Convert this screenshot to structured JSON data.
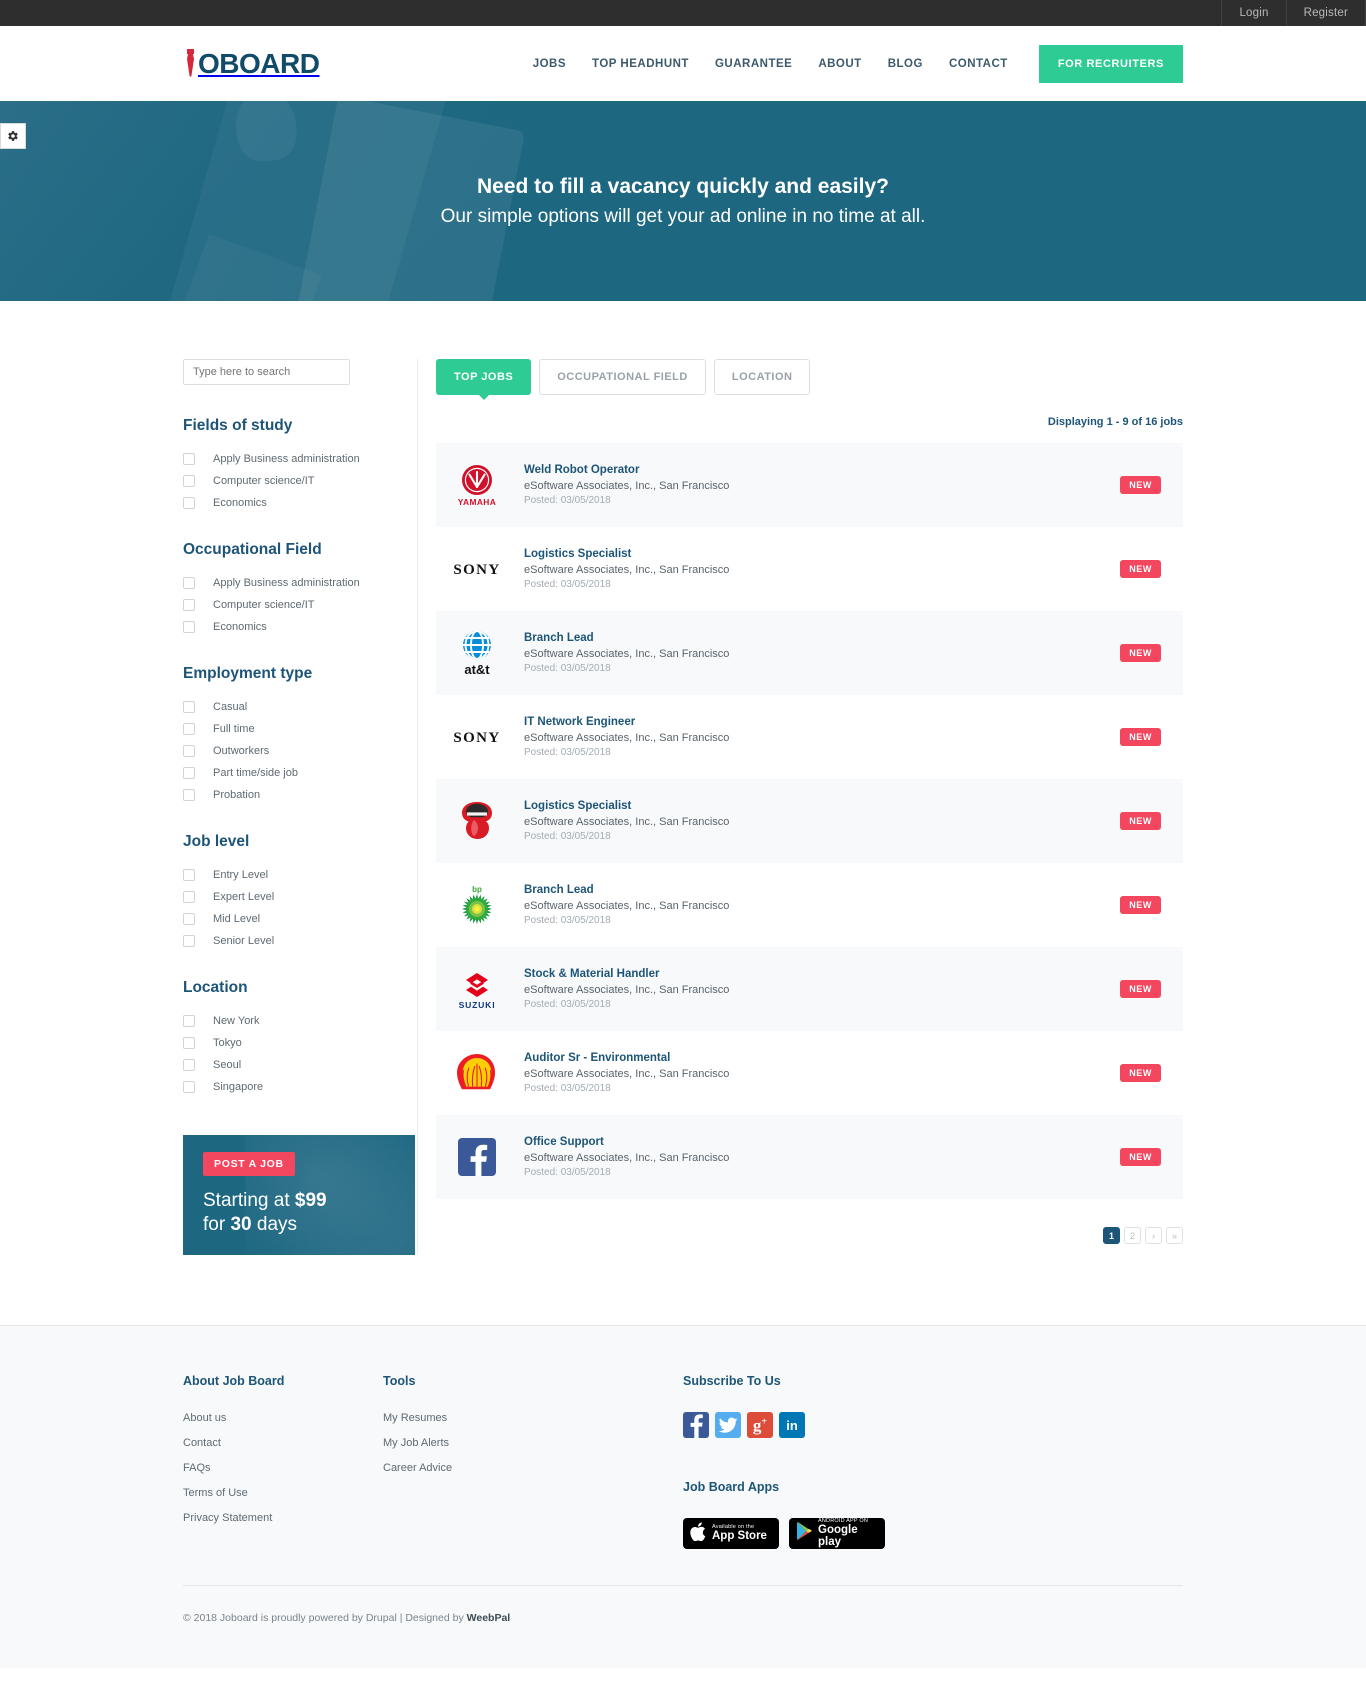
{
  "topbar": {
    "login": "Login",
    "register": "Register"
  },
  "header": {
    "logo_text": "OBOARD",
    "nav": [
      {
        "label": "JOBS"
      },
      {
        "label": "TOP HEADHUNT"
      },
      {
        "label": "GUARANTEE"
      },
      {
        "label": "ABOUT"
      },
      {
        "label": "BLOG"
      },
      {
        "label": "CONTACT"
      }
    ],
    "cta": "FOR RECRUITERS"
  },
  "hero": {
    "title": "Need to fill a vacancy quickly and easily?",
    "subtitle": "Our simple options will get your ad online in no time at all.",
    "settings_icon": "gear-icon"
  },
  "sidebar": {
    "search_placeholder": "Type here to search",
    "groups": [
      {
        "title": "Fields of study",
        "options": [
          "Apply Business administration",
          "Computer science/IT",
          "Economics"
        ]
      },
      {
        "title": "Occupational Field",
        "options": [
          "Apply Business administration",
          "Computer science/IT",
          "Economics"
        ]
      },
      {
        "title": "Employment type",
        "options": [
          "Casual",
          "Full time",
          "Outworkers",
          "Part time/side job",
          "Probation"
        ]
      },
      {
        "title": "Job level",
        "options": [
          "Entry Level",
          "Expert Level",
          "Mid Level",
          "Senior Level"
        ]
      },
      {
        "title": "Location",
        "options": [
          "New York",
          "Tokyo",
          "Seoul",
          "Singapore"
        ]
      }
    ],
    "promo": {
      "badge": "POST A JOB",
      "line1_pre": "Starting at ",
      "line1_strong": "$99",
      "line2_pre": "for ",
      "line2_strong": "30",
      "line2_post": " days"
    }
  },
  "content": {
    "tabs": [
      {
        "label": "TOP JOBS",
        "active": true
      },
      {
        "label": "OCCUPATIONAL FIELD",
        "active": false
      },
      {
        "label": "LOCATION",
        "active": false
      }
    ],
    "displaying": "Displaying 1 - 9 of 16 jobs",
    "jobs": [
      {
        "logo": "yamaha-logo",
        "title": "Weld Robot Operator",
        "company": "eSoftware Associates, Inc., San Francisco",
        "posted": "Posted: 03/05/2018",
        "badge": "NEW"
      },
      {
        "logo": "sony-logo",
        "title": "Logistics Specialist",
        "company": "eSoftware Associates, Inc., San Francisco",
        "posted": "Posted: 03/05/2018",
        "badge": "NEW"
      },
      {
        "logo": "att-logo",
        "title": "Branch Lead",
        "company": "eSoftware Associates, Inc., San Francisco",
        "posted": "Posted: 03/05/2018",
        "badge": "NEW"
      },
      {
        "logo": "sony-logo",
        "title": "IT Network Engineer",
        "company": "eSoftware Associates, Inc., San Francisco",
        "posted": "Posted: 03/05/2018",
        "badge": "NEW"
      },
      {
        "logo": "tongue-logo",
        "title": "Logistics Specialist",
        "company": "eSoftware Associates, Inc., San Francisco",
        "posted": "Posted: 03/05/2018",
        "badge": "NEW"
      },
      {
        "logo": "bp-logo",
        "title": "Branch Lead",
        "company": "eSoftware Associates, Inc., San Francisco",
        "posted": "Posted: 03/05/2018",
        "badge": "NEW"
      },
      {
        "logo": "suzuki-logo",
        "title": "Stock & Material Handler",
        "company": "eSoftware Associates, Inc., San Francisco",
        "posted": "Posted: 03/05/2018",
        "badge": "NEW"
      },
      {
        "logo": "shell-logo",
        "title": "Auditor Sr - Environmental",
        "company": "eSoftware Associates, Inc., San Francisco",
        "posted": "Posted: 03/05/2018",
        "badge": "NEW"
      },
      {
        "logo": "facebook-logo",
        "title": "Office Support",
        "company": "eSoftware Associates, Inc., San Francisco",
        "posted": "Posted: 03/05/2018",
        "badge": "NEW"
      }
    ],
    "pagination": [
      {
        "label": "1",
        "active": true
      },
      {
        "label": "2",
        "active": false
      },
      {
        "label": "›",
        "active": false
      },
      {
        "label": "»",
        "active": false
      }
    ]
  },
  "footer": {
    "about_title": "About Job Board",
    "about_links": [
      "About us",
      "Contact",
      "FAQs",
      "Terms of Use",
      "Privacy Statement"
    ],
    "tools_title": "Tools",
    "tools_links": [
      "My Resumes",
      "My Job Alerts",
      "Career Advice"
    ],
    "subscribe_title": "Subscribe To Us",
    "socials": [
      {
        "name": "facebook-icon",
        "glyph": "f",
        "color": "#3b5998"
      },
      {
        "name": "twitter-icon",
        "glyph": "✆",
        "color": "#55acee"
      },
      {
        "name": "googleplus-icon",
        "glyph": "g+",
        "color": "#dd4b39"
      },
      {
        "name": "linkedin-icon",
        "glyph": "in",
        "color": "#0077b5"
      }
    ],
    "apps_title": "Job Board Apps",
    "apps": [
      {
        "small": "Available on the",
        "big": "App Store",
        "icon": "apple-icon"
      },
      {
        "small": "ANDROID APP ON",
        "big": "Google play",
        "icon": "play-icon"
      }
    ],
    "copyright_pre": "© 2018 Joboard is proudly powered by Drupal | Designed by ",
    "copyright_brand": "WeebPal"
  },
  "colors": {
    "accent_green": "#2ecc94",
    "brand_blue": "#1d5578",
    "hero_teal": "#1d6781",
    "badge_red": "#f2475f",
    "topbar_dark": "#2e2e2e"
  }
}
